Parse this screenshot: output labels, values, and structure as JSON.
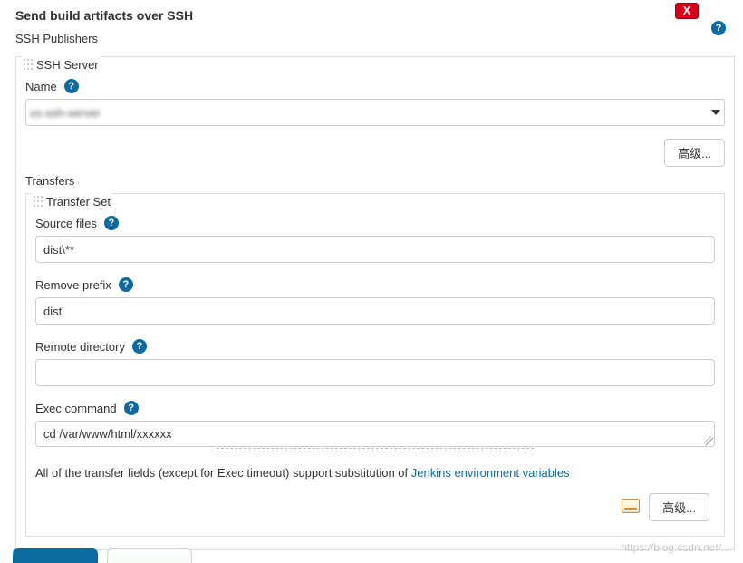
{
  "header": {
    "title": "Send build artifacts over SSH",
    "close_label": "X",
    "publishers_label": "SSH Publishers"
  },
  "ssh_server": {
    "legend": "SSH Server",
    "name_label": "Name",
    "name_value": "xs-ssh-server",
    "advanced_label": "高级..."
  },
  "transfers": {
    "label": "Transfers",
    "set_legend": "Transfer Set",
    "source_files_label": "Source files",
    "source_files_value": "dist\\**",
    "remove_prefix_label": "Remove prefix",
    "remove_prefix_value": "dist",
    "remote_dir_label": "Remote directory",
    "remote_dir_value": "",
    "exec_label": "Exec command",
    "exec_value": "cd /var/www/html/xxxxxx",
    "note_prefix": "All of the transfer fields (except for Exec timeout) support substitution of ",
    "note_link": "Jenkins environment variables",
    "advanced_label": "高级..."
  },
  "watermark": "https://blog.csdn.net/..."
}
